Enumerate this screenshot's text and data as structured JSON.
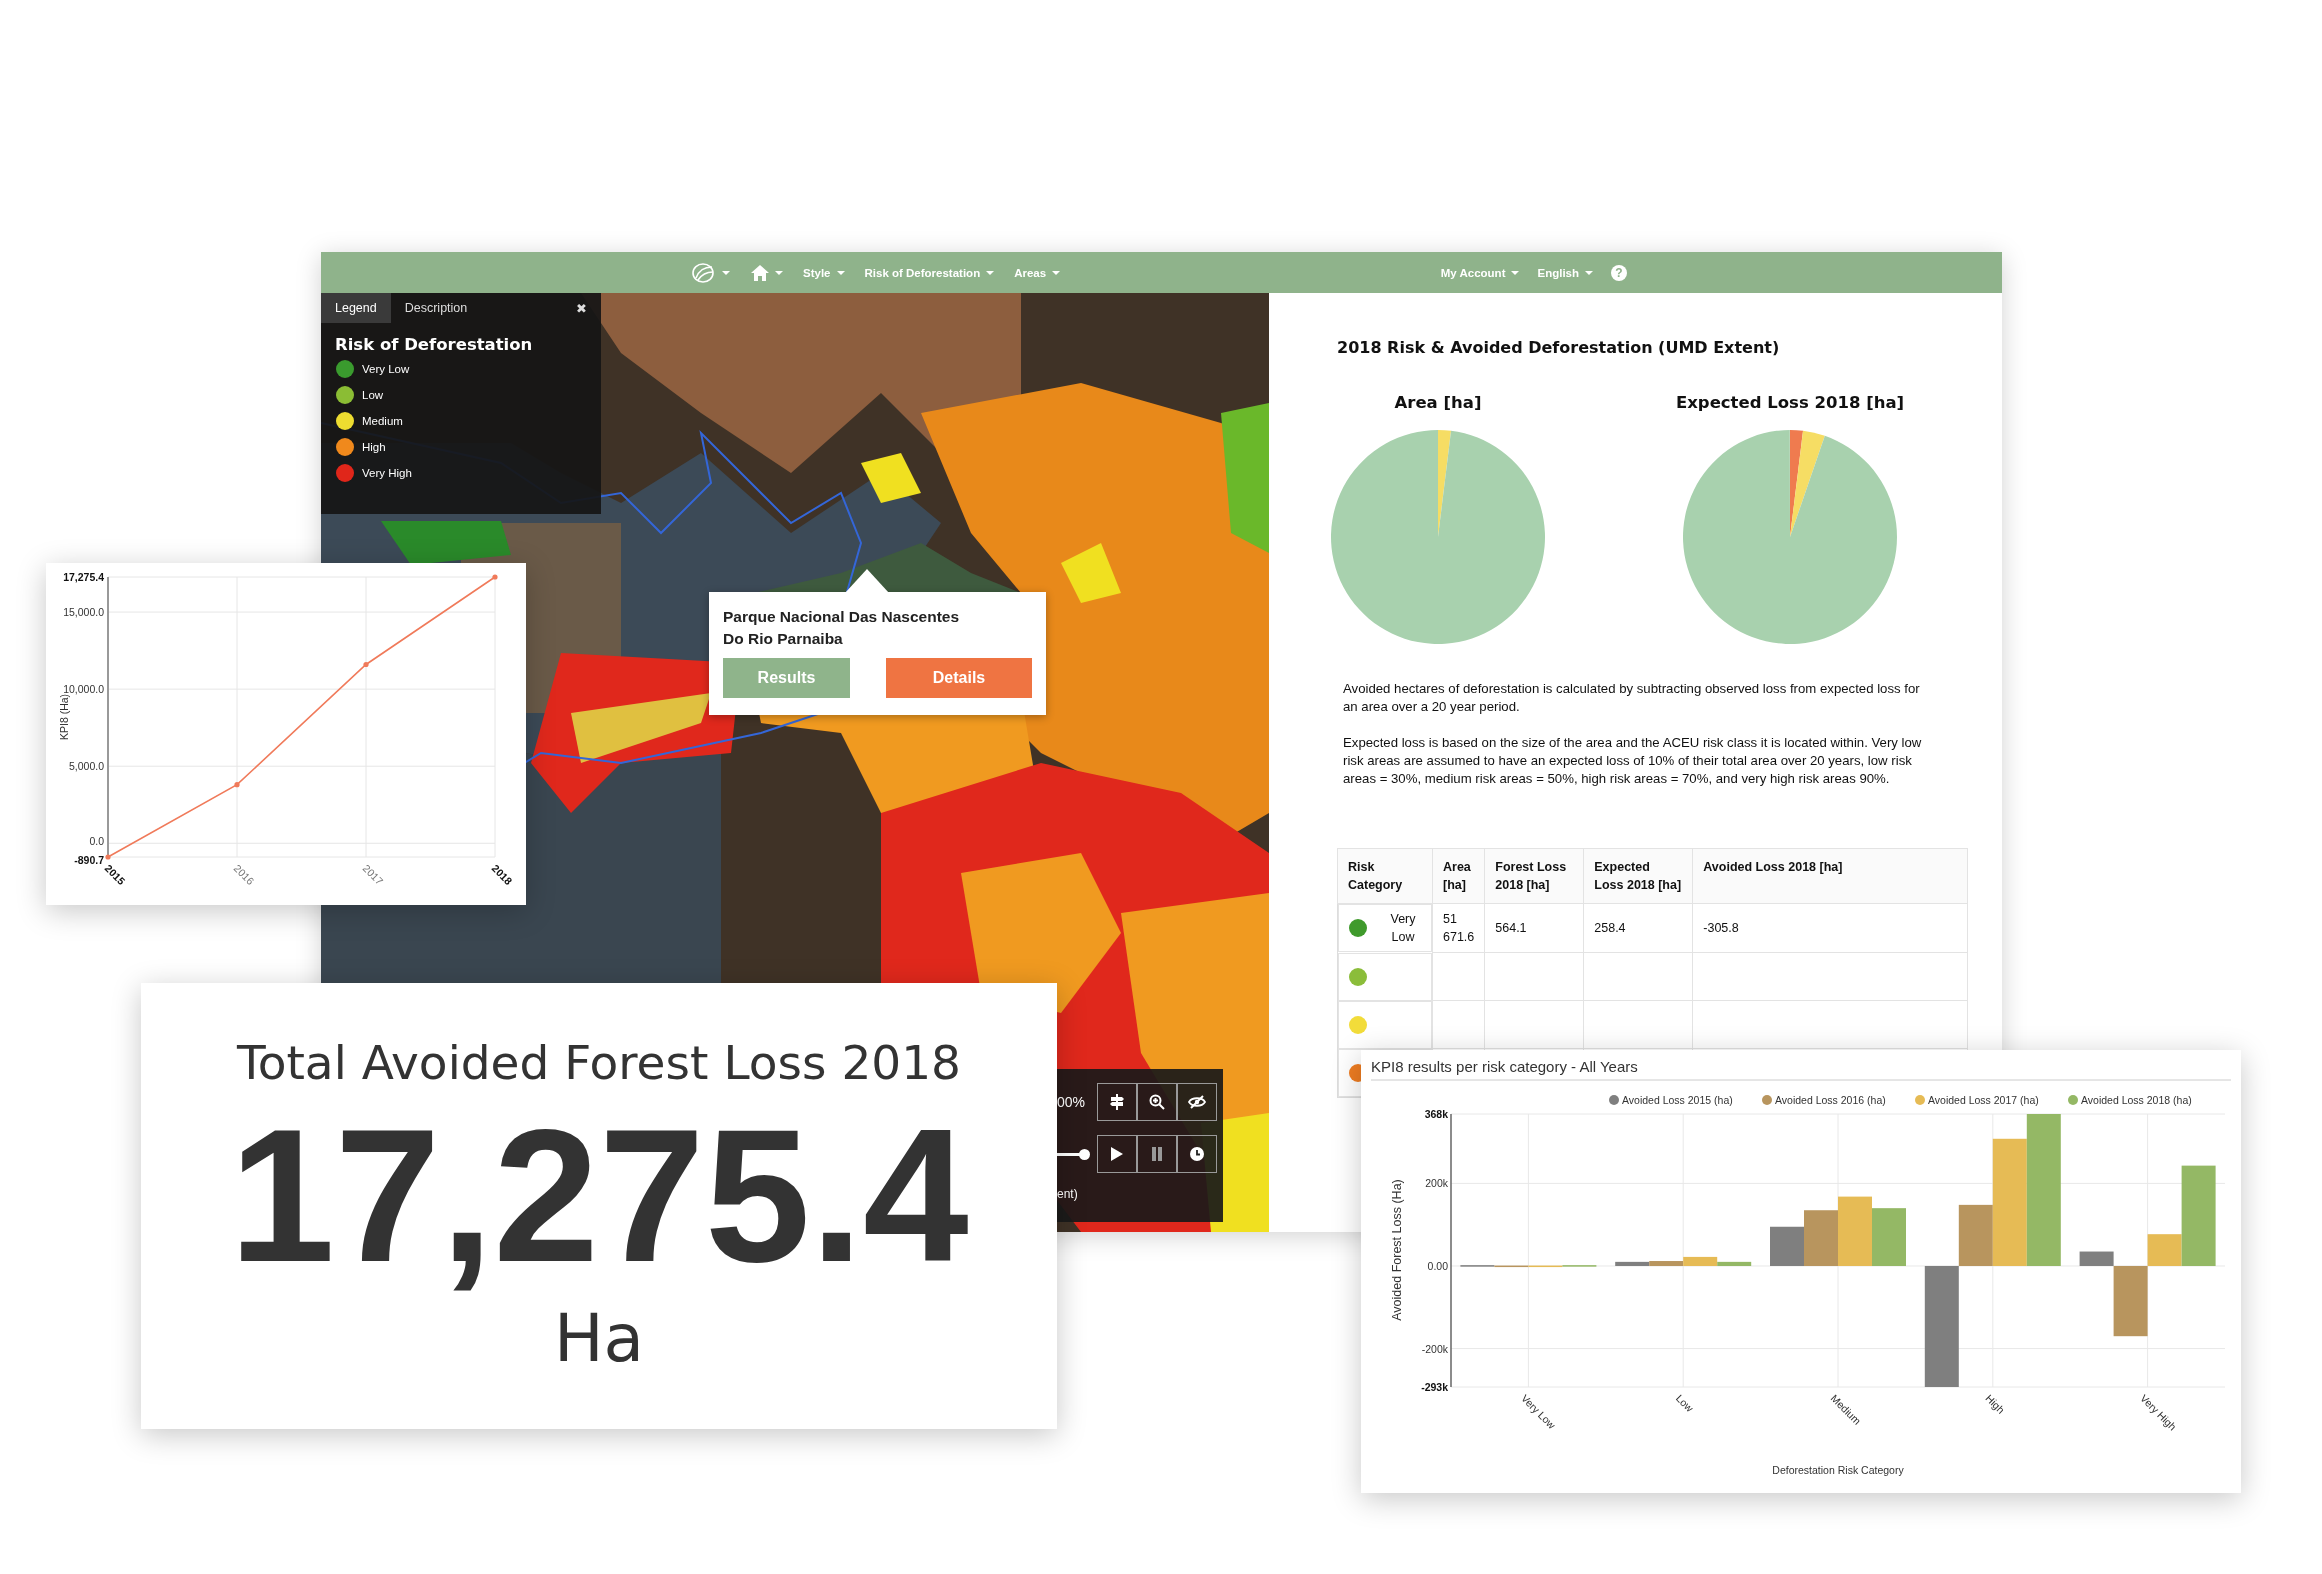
{
  "nav": {
    "left_menus": [
      "Style",
      "Risk of Deforestation",
      "Areas"
    ],
    "right_menus": [
      "My Account",
      "English"
    ],
    "help": "?"
  },
  "legend": {
    "tabs": [
      {
        "label": "Legend",
        "selected": true
      },
      {
        "label": "Description",
        "selected": false
      }
    ],
    "close": "✖",
    "title": "Risk of Deforestation",
    "items": [
      {
        "label": "Very Low",
        "color": "#3a9b2e"
      },
      {
        "label": "Low",
        "color": "#8bbd34"
      },
      {
        "label": "Medium",
        "color": "#eedd30"
      },
      {
        "label": "High",
        "color": "#f0891c"
      },
      {
        "label": "Very High",
        "color": "#e0261a"
      }
    ]
  },
  "popup": {
    "title": "Parque Nacional Das Nascentes Do Rio Parnaiba",
    "buttons": [
      {
        "label": "Results",
        "kind": "primary"
      },
      {
        "label": "Details",
        "kind": "accent"
      }
    ]
  },
  "map_controls": {
    "opacity": "00%",
    "slider": {
      "level": 1
    },
    "caption": "ent)"
  },
  "report": {
    "title": "2018 Risk & Avoided Deforestation (UMD Extent)",
    "pies": [
      {
        "title": "Area [ha]"
      },
      {
        "title": "Expected Loss 2018 [ha]"
      }
    ],
    "paragraphs": [
      "Avoided hectares of deforestation is calculated by subtracting observed loss from expected loss for an area over a 20 year period.",
      "Expected loss is based on the size of the area and the ACEU risk class it is located within. Very low risk areas are assumed to have an expected loss of 10% of their total area over 20 years, low risk areas = 30%, medium risk areas = 50%, high risk areas = 70%, and very high risk areas 90%."
    ],
    "table": {
      "columns": [
        "Risk Category",
        "Area [ha]",
        "Forest Loss 2018 [ha]",
        "Expected Loss 2018 [ha]",
        "Avoided Loss 2018 [ha]"
      ],
      "rows": [
        {
          "color": "#3f9a2c",
          "category": "Very Low",
          "cells": [
            "51 671.6",
            "564.1",
            "258.4",
            "-305.8"
          ]
        },
        {
          "color": "#8bbd3a"
        },
        {
          "color": "#f2dc3a"
        },
        {
          "color": "#ef7d22"
        }
      ]
    }
  },
  "trend_chart": {
    "chart_data": {
      "type": "line",
      "ylabel": "KPI8 (Ha)",
      "x": [
        "2015",
        "2016",
        "2017",
        "2018"
      ],
      "series": [
        {
          "color": "#f07a5a",
          "values": [
            -890.7,
            3800,
            11600,
            17275.4
          ]
        }
      ],
      "grid": true,
      "ylim": [
        -890.7,
        17275.4
      ],
      "yticks": [
        {
          "value": -890.7,
          "label": "-890.7"
        },
        {
          "value": 0,
          "label": "0.0"
        },
        {
          "value": 5000,
          "label": "5,000.0"
        },
        {
          "value": 10000,
          "label": "10,000.0"
        },
        {
          "value": 15000,
          "label": "15,000.0"
        },
        {
          "value": 17275.4,
          "label": "17,275.4"
        }
      ]
    }
  },
  "total_card": {
    "title": "Total Avoided Forest Loss 2018",
    "value": "17,275.4",
    "unit": "Ha"
  },
  "bar_chart": {
    "chart_data": {
      "type": "bar",
      "title": "KPI8 results per risk category - All Years",
      "xlabel": "Deforestation Risk Category",
      "ylabel": "Avoided Forest Loss (Ha)",
      "categories": [
        "Very Low",
        "Low",
        "Medium",
        "High",
        "Very High"
      ],
      "series": [
        {
          "name": "Avoided Loss 2015 (ha)",
          "color": "#7f7f7f",
          "values": [
            2000,
            10000,
            95000,
            -293000,
            35000
          ]
        },
        {
          "name": "Avoided Loss 2016 (ha)",
          "color": "#b8955e",
          "values": [
            1000,
            12000,
            135000,
            148000,
            -170000
          ]
        },
        {
          "name": "Avoided Loss 2017 (ha)",
          "color": "#e6bb55",
          "values": [
            1000,
            22000,
            168000,
            308000,
            77000
          ]
        },
        {
          "name": "Avoided Loss 2018 (ha)",
          "color": "#94b865",
          "values": [
            2000,
            10000,
            140000,
            368000,
            243000
          ]
        }
      ],
      "ylim": [
        -293000,
        368000
      ],
      "grid": true,
      "legend": true,
      "yticks": [
        {
          "value": -293000,
          "label": "-293k"
        },
        {
          "value": -200000,
          "label": "-200k"
        },
        {
          "value": 0,
          "label": "0.00"
        },
        {
          "value": 200000,
          "label": "200k"
        },
        {
          "value": 368000,
          "label": "368k"
        }
      ]
    }
  }
}
